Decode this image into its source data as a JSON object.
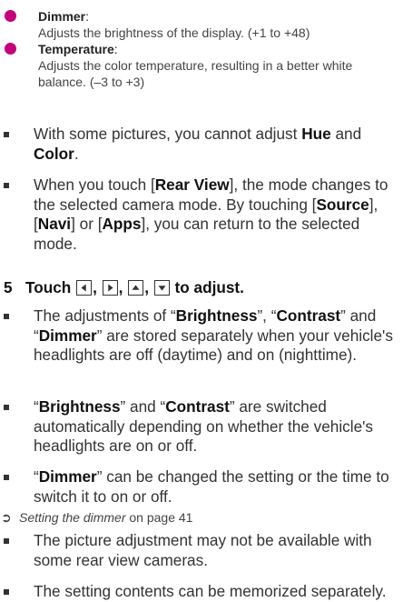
{
  "options": [
    {
      "term": "Dimmer",
      "colon": ":",
      "desc_lines": [
        "Adjusts the brightness of the display. (+1 to +48)"
      ]
    },
    {
      "term": "Temperature",
      "colon": ":",
      "desc_lines": [
        "Adjusts the color temperature, resulting in a better white",
        "balance. (–3 to +3)"
      ]
    }
  ],
  "bullets_1": [
    {
      "t1": "With some pictures, you cannot adjust ",
      "b1": "Hue",
      "t2": " and ",
      "b2": "Color",
      "t3": "."
    },
    {
      "t1": "When you touch [",
      "b1": "Rear View",
      "t2": "], the mode changes to the selected camera mode. By touching [",
      "b2": "Source",
      "t3": "], [",
      "b3": "Navi",
      "t4": "] or [",
      "b4": "Apps",
      "t5": "], you can return to the selected mode."
    }
  ],
  "step": {
    "number": "5",
    "touch": "Touch",
    "comma": ",",
    "suffix": "to adjust.",
    "keys": [
      "left-arrow-icon",
      "right-arrow-icon",
      "up-arrow-icon",
      "down-arrow-icon"
    ]
  },
  "bullets_2": [
    {
      "t1": "The adjustments of “",
      "b1": "Brightness",
      "t2": "”, “",
      "b2": "Contrast",
      "t3": "” and “",
      "b3": "Dimmer",
      "t4": "” are stored separately when your vehicle's headlights are off (daytime) and on (nighttime)."
    },
    {
      "t1": "“",
      "b1": "Brightness",
      "t2": "” and “",
      "b2": "Contrast",
      "t3": "” are switched automatically depending on whether the vehicle's headlights are on or off."
    },
    {
      "t1": "“",
      "b1": "Dimmer",
      "t2": "” can be changed the setting or the time to switch it to on or off."
    }
  ],
  "xref": {
    "arrow": "➲",
    "title": "Setting the dimmer",
    "page_text": " on page 41"
  },
  "bullets_3": [
    {
      "text": "The picture adjustment may not be available with some rear view cameras."
    },
    {
      "text": "The setting contents can be memorized separately."
    }
  ],
  "colors": {
    "option_dot": "#c4007a",
    "text": "#333333",
    "bold": "#111111"
  }
}
